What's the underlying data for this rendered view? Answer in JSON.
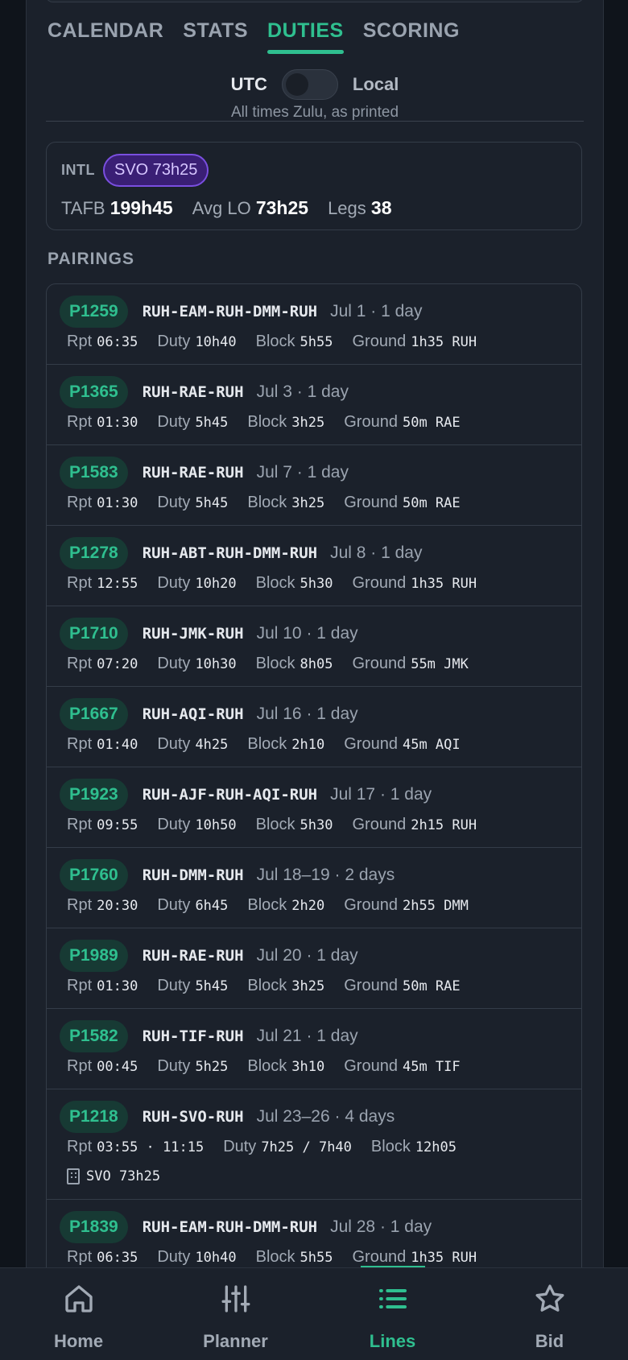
{
  "tabs": [
    "CALENDAR",
    "STATS",
    "DUTIES",
    "SCORING"
  ],
  "active_tab": "DUTIES",
  "timezone": {
    "left": "UTC",
    "right": "Local",
    "note": "All times Zulu, as printed"
  },
  "summary": {
    "tag": "INTL",
    "badge": "SVO 73h25",
    "tafb_label": "TAFB",
    "tafb": "199h45",
    "avglo_label": "Avg LO",
    "avglo": "73h25",
    "legs_label": "Legs",
    "legs": "38"
  },
  "pairings_heading": "PAIRINGS",
  "labels": {
    "rpt": "Rpt",
    "duty": "Duty",
    "block": "Block",
    "ground": "Ground"
  },
  "pairings": [
    {
      "id": "P1259",
      "route": "RUH-EAM-RUH-DMM-RUH",
      "dates": "Jul 1 · 1 day",
      "rpt": "06:35",
      "duty": "10h40",
      "block": "5h55",
      "ground": "1h35 RUH"
    },
    {
      "id": "P1365",
      "route": "RUH-RAE-RUH",
      "dates": "Jul 3 · 1 day",
      "rpt": "01:30",
      "duty": "5h45",
      "block": "3h25",
      "ground": "50m RAE"
    },
    {
      "id": "P1583",
      "route": "RUH-RAE-RUH",
      "dates": "Jul 7 · 1 day",
      "rpt": "01:30",
      "duty": "5h45",
      "block": "3h25",
      "ground": "50m RAE"
    },
    {
      "id": "P1278",
      "route": "RUH-ABT-RUH-DMM-RUH",
      "dates": "Jul 8 · 1 day",
      "rpt": "12:55",
      "duty": "10h20",
      "block": "5h30",
      "ground": "1h35 RUH"
    },
    {
      "id": "P1710",
      "route": "RUH-JMK-RUH",
      "dates": "Jul 10 · 1 day",
      "rpt": "07:20",
      "duty": "10h30",
      "block": "8h05",
      "ground": "55m JMK"
    },
    {
      "id": "P1667",
      "route": "RUH-AQI-RUH",
      "dates": "Jul 16 · 1 day",
      "rpt": "01:40",
      "duty": "4h25",
      "block": "2h10",
      "ground": "45m AQI"
    },
    {
      "id": "P1923",
      "route": "RUH-AJF-RUH-AQI-RUH",
      "dates": "Jul 17 · 1 day",
      "rpt": "09:55",
      "duty": "10h50",
      "block": "5h30",
      "ground": "2h15 RUH"
    },
    {
      "id": "P1760",
      "route": "RUH-DMM-RUH",
      "dates": "Jul 18–19 · 2 days",
      "rpt": "20:30",
      "duty": "6h45",
      "block": "2h20",
      "ground": "2h55 DMM"
    },
    {
      "id": "P1989",
      "route": "RUH-RAE-RUH",
      "dates": "Jul 20 · 1 day",
      "rpt": "01:30",
      "duty": "5h45",
      "block": "3h25",
      "ground": "50m RAE"
    },
    {
      "id": "P1582",
      "route": "RUH-TIF-RUH",
      "dates": "Jul 21 · 1 day",
      "rpt": "00:45",
      "duty": "5h25",
      "block": "3h10",
      "ground": "45m TIF"
    },
    {
      "id": "P1218",
      "route": "RUH-SVO-RUH",
      "dates": "Jul 23–26 · 4 days",
      "rpt": "03:55 · 11:15",
      "duty": "7h25 / 7h40",
      "block": "12h05",
      "ground": "",
      "layover": "SVO 73h25"
    },
    {
      "id": "P1839",
      "route": "RUH-EAM-RUH-DMM-RUH",
      "dates": "Jul 28 · 1 day",
      "rpt": "06:35",
      "duty": "10h40",
      "block": "5h55",
      "ground": "1h35 RUH"
    }
  ],
  "nav": [
    {
      "label": "Home",
      "icon": "home-icon"
    },
    {
      "label": "Planner",
      "icon": "sliders-icon"
    },
    {
      "label": "Lines",
      "icon": "list-icon"
    },
    {
      "label": "Bid",
      "icon": "star-icon"
    }
  ],
  "active_nav": "Lines",
  "colors": {
    "accent": "#2fbf8f",
    "badge_purple": "#7a4fe0",
    "background": "#1b212b"
  }
}
